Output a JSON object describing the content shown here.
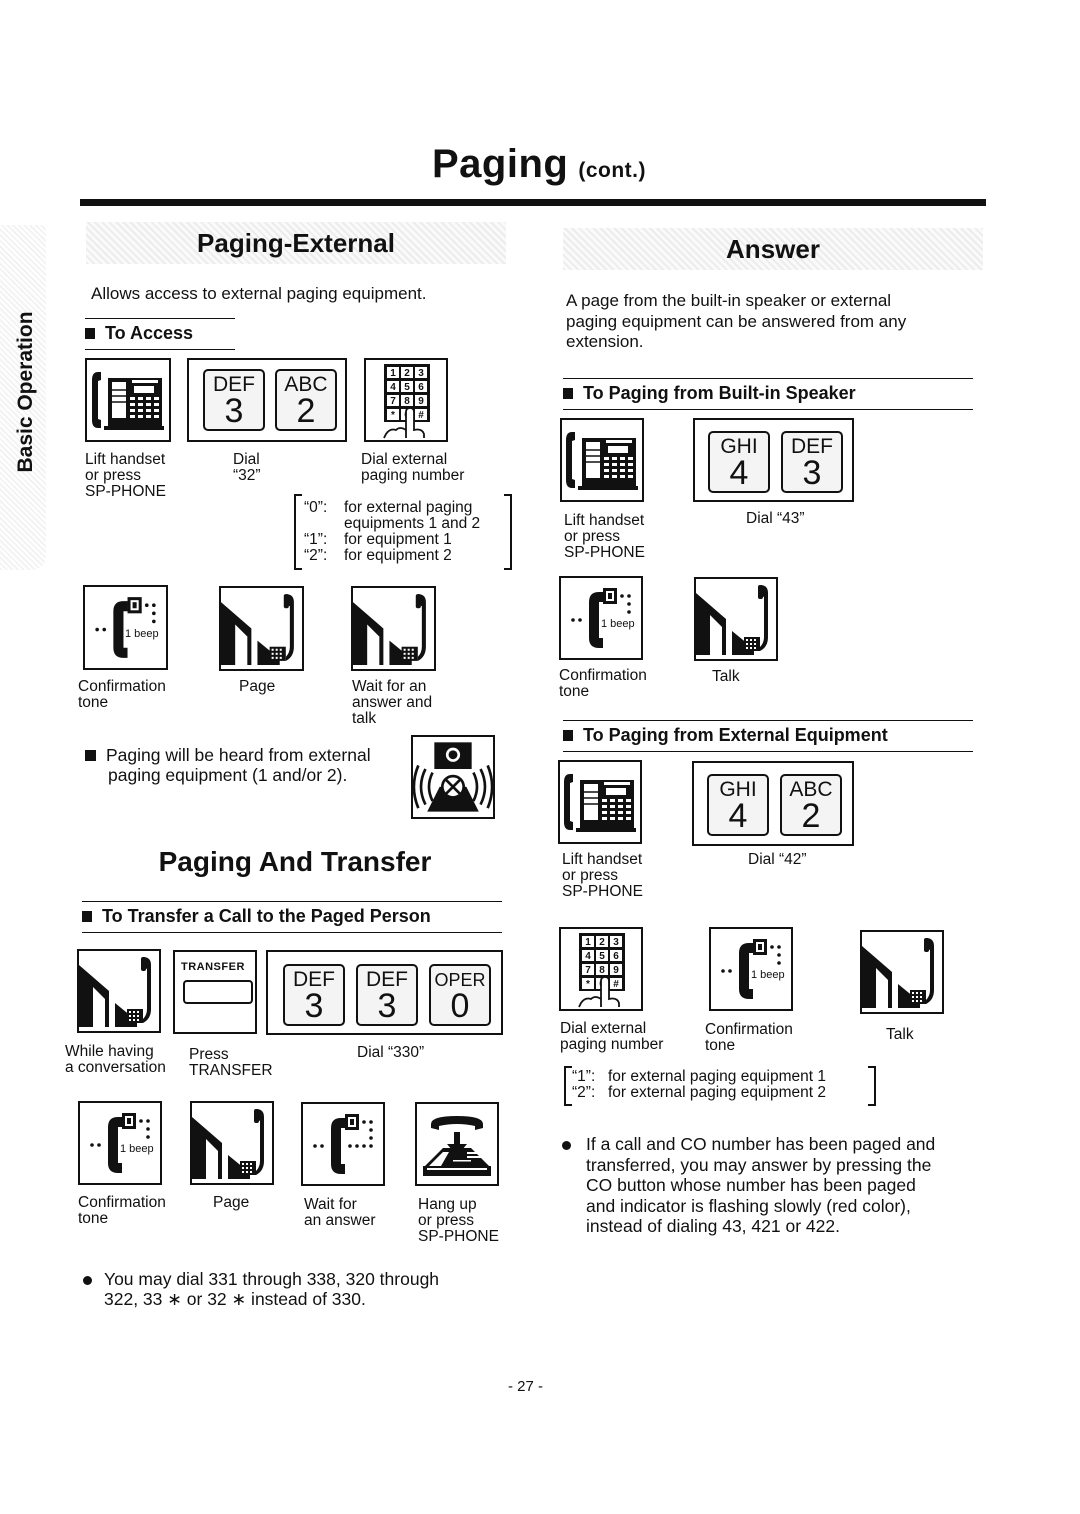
{
  "header": {
    "title": "Paging",
    "title_suffix": "(cont.)"
  },
  "side_tab": {
    "label": "Basic Operation"
  },
  "paging_external": {
    "heading": "Paging-External",
    "description": "Allows access to external paging equipment.",
    "to_access": {
      "heading": "To Access",
      "steps": [
        {
          "icon": "phone-handset-icon",
          "caption_lines": [
            "Lift handset",
            "or press",
            "SP-PHONE"
          ]
        },
        {
          "icon": "dial-keys-icon",
          "keys": [
            {
              "letters": "DEF",
              "digit": "3"
            },
            {
              "letters": "ABC",
              "digit": "2"
            }
          ],
          "caption_lines": [
            "Dial",
            "“32”"
          ]
        },
        {
          "icon": "keypad-finger-icon",
          "caption_lines": [
            "Dial external",
            "paging number"
          ]
        }
      ],
      "note_lines": [
        {
          "code": "“0”:",
          "text": "for external paging"
        },
        {
          "code": "",
          "text": "equipments 1 and 2"
        },
        {
          "code": "“1”:",
          "text": "for equipment 1"
        },
        {
          "code": "“2”:",
          "text": "for equipment 2"
        }
      ],
      "steps2": [
        {
          "icon": "confirmation-tone-icon",
          "beep_label": "1 beep",
          "caption_lines": [
            "Confirmation",
            "tone"
          ]
        },
        {
          "icon": "page-talk-icon",
          "caption_lines": [
            "Page"
          ]
        },
        {
          "icon": "page-talk-icon",
          "caption_lines": [
            "Wait for an",
            "answer and",
            "talk"
          ]
        }
      ],
      "info_lines": [
        "Paging will be heard from external",
        "paging equipment (1 and/or 2)."
      ]
    }
  },
  "paging_transfer": {
    "heading": "Paging And Transfer",
    "sub_heading": "To Transfer a Call to the Paged Person",
    "steps": [
      {
        "icon": "page-talk-icon",
        "caption_lines": [
          "While having",
          "a conversation"
        ]
      },
      {
        "icon": "transfer-button-icon",
        "button_label": "TRANSFER",
        "caption_lines": [
          "Press",
          "TRANSFER"
        ]
      },
      {
        "icon": "dial-keys-icon",
        "keys": [
          {
            "letters": "DEF",
            "digit": "3"
          },
          {
            "letters": "DEF",
            "digit": "3"
          },
          {
            "letters": "OPER",
            "digit": "0"
          }
        ],
        "caption_lines": [
          "Dial “330”"
        ]
      }
    ],
    "steps2": [
      {
        "icon": "confirmation-tone-icon",
        "beep_label": "1 beep",
        "caption_lines": [
          "Confirmation",
          "tone"
        ]
      },
      {
        "icon": "page-talk-icon",
        "caption_lines": [
          "Page"
        ]
      },
      {
        "icon": "waiting-tone-icon",
        "caption_lines": [
          "Wait for",
          "an answer"
        ]
      },
      {
        "icon": "hang-up-icon",
        "caption_lines": [
          "Hang up",
          "or press",
          "SP-PHONE"
        ]
      }
    ],
    "bullet_lines": [
      "You may dial 331 through 338, 320 through",
      "322, 33 ∗ or 32 ∗  instead of 330."
    ]
  },
  "answer": {
    "heading": "Answer",
    "description_lines": [
      "A page from the built-in speaker or external",
      "paging equipment can be answered from any",
      "extension."
    ],
    "builtin": {
      "heading": "To Paging from Built-in Speaker",
      "steps": [
        {
          "icon": "phone-handset-icon",
          "caption_lines": [
            "Lift handset",
            "or press",
            "SP-PHONE"
          ]
        },
        {
          "icon": "dial-keys-icon",
          "keys": [
            {
              "letters": "GHI",
              "digit": "4"
            },
            {
              "letters": "DEF",
              "digit": "3"
            }
          ],
          "caption_lines": [
            "Dial “43”"
          ]
        }
      ],
      "steps2": [
        {
          "icon": "confirmation-tone-icon",
          "beep_label": "1 beep",
          "caption_lines": [
            "Confirmation",
            "tone"
          ]
        },
        {
          "icon": "page-talk-icon",
          "caption_lines": [
            "Talk"
          ]
        }
      ]
    },
    "external": {
      "heading": "To Paging from External Equipment",
      "steps": [
        {
          "icon": "phone-handset-icon",
          "caption_lines": [
            "Lift handset",
            "or press",
            "SP-PHONE"
          ]
        },
        {
          "icon": "dial-keys-icon",
          "keys": [
            {
              "letters": "GHI",
              "digit": "4"
            },
            {
              "letters": "ABC",
              "digit": "2"
            }
          ],
          "caption_lines": [
            "Dial “42”"
          ]
        }
      ],
      "steps2": [
        {
          "icon": "keypad-finger-icon",
          "caption_lines": [
            "Dial external",
            "paging number"
          ]
        },
        {
          "icon": "confirmation-tone-icon",
          "beep_label": "1 beep",
          "caption_lines": [
            "Confirmation",
            "tone"
          ]
        },
        {
          "icon": "page-talk-icon",
          "caption_lines": [
            "Talk"
          ]
        }
      ],
      "note_lines": [
        {
          "code": "“1”:",
          "text": "for external paging equipment 1"
        },
        {
          "code": "“2”:",
          "text": "for external paging equipment 2"
        }
      ]
    },
    "bullet_lines": [
      "If a call and CO number has been paged and",
      "transferred, you may answer by pressing the",
      "CO button whose number has been paged",
      "and indicator is flashing slowly (red color),",
      "instead of dialing 43, 421 or 422."
    ]
  },
  "footer": {
    "page_number": "- 27 -"
  }
}
